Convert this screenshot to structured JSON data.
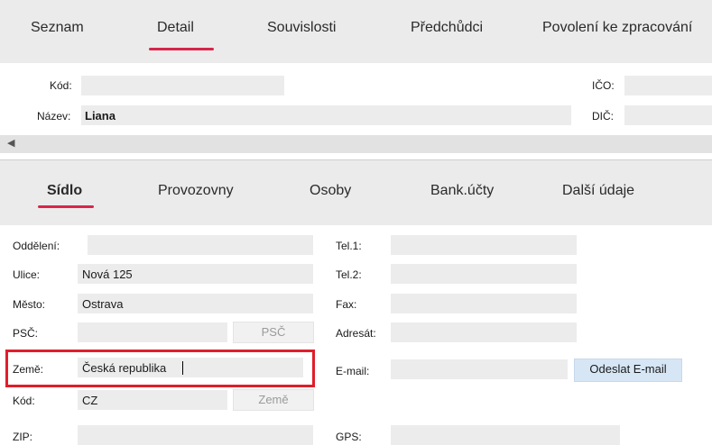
{
  "top_tabs": [
    "Seznam",
    "Detail",
    "Souvislosti",
    "Předchůdci",
    "Povolení ke zpracování"
  ],
  "header_form": {
    "kod_label": "Kód:",
    "kod_value": "",
    "nazev_label": "Název:",
    "nazev_value": "Liana",
    "ico_label": "IČO:",
    "dic_label": "DIČ:"
  },
  "scroll_left_glyph": "◀",
  "sub_tabs": [
    "Sídlo",
    "Provozovny",
    "Osoby",
    "Bank.účty",
    "Další údaje"
  ],
  "form": {
    "oddeleni_label": "Oddělení:",
    "ulice_label": "Ulice:",
    "ulice_value": "Nová 125",
    "mesto_label": "Město:",
    "mesto_value": "Ostrava",
    "psc_label": "PSČ:",
    "psc_button": "PSČ",
    "zeme_label": "Země:",
    "zeme_value": "Česká republika",
    "kod_label": "Kód:",
    "kod_value": "CZ",
    "zeme_button": "Země",
    "zip_label": "ZIP:",
    "tel1_label": "Tel.1:",
    "tel2_label": "Tel.2:",
    "fax_label": "Fax:",
    "adresat_label": "Adresát:",
    "email_label": "E-mail:",
    "email_button": "Odeslat E-mail",
    "gps_label": "GPS:"
  },
  "colors": {
    "accent_underline": "#d6264a",
    "highlight_box": "#e01e2b",
    "email_button_bg": "#d6e6f5"
  }
}
